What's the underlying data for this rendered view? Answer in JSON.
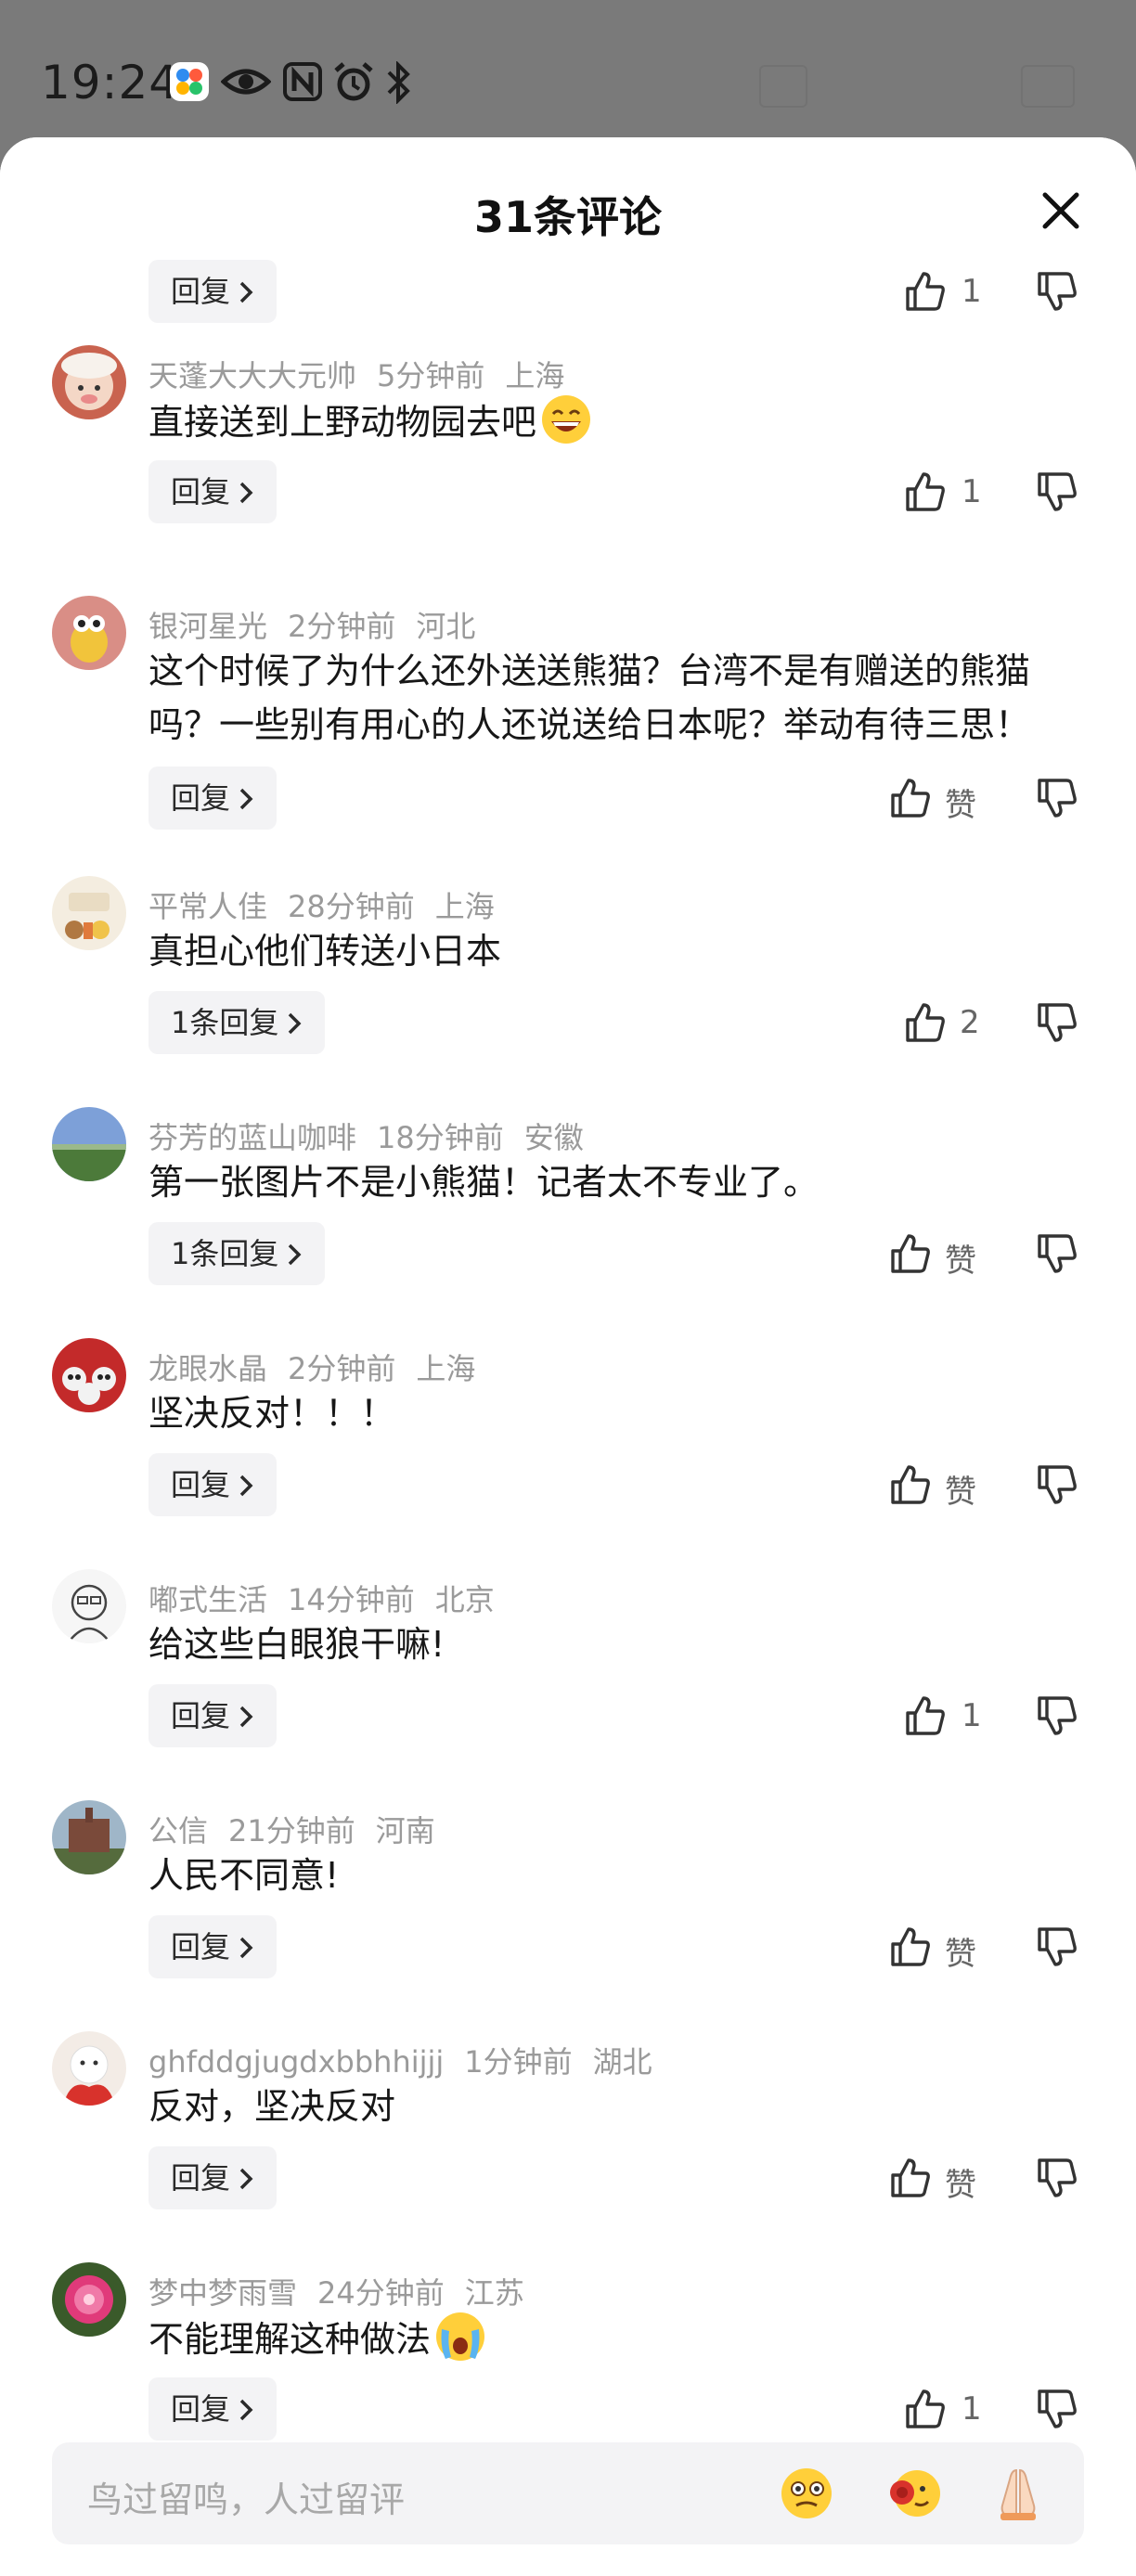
{
  "status_bar": {
    "time": "19:24",
    "icons": [
      "app-icon",
      "eye-icon",
      "nfc-icon",
      "alarm-icon",
      "bluetooth-icon"
    ]
  },
  "sheet": {
    "title": "31条评论",
    "close_icon": "close-icon"
  },
  "partial_top": {
    "reply_label": "回复",
    "like_count": "1"
  },
  "comments": [
    {
      "user": "天蓬大大大元帅",
      "time": "5分钟前",
      "location": "上海",
      "text": "直接送到上野动物园去吧",
      "emoji": "grinning-face",
      "reply_label": "回复",
      "likes": "1"
    },
    {
      "user": "银河星光",
      "time": "2分钟前",
      "location": "河北",
      "text": "这个时候了为什么还外送送熊猫？台湾不是有赠送的熊猫吗？一些别有用心的人还说送给日本呢？举动有待三思！",
      "reply_label": "回复",
      "likes": "赞"
    },
    {
      "user": "平常人佳",
      "time": "28分钟前",
      "location": "上海",
      "text": "真担心他们转送小日本",
      "reply_label": "1条回复",
      "likes": "2"
    },
    {
      "user": "芬芳的蓝山咖啡",
      "time": "18分钟前",
      "location": "安徽",
      "text": "第一张图片不是小熊猫！记者太不专业了。",
      "reply_label": "1条回复",
      "likes": "赞"
    },
    {
      "user": "龙眼水晶",
      "time": "2分钟前",
      "location": "上海",
      "text": "坚决反对！！！",
      "reply_label": "回复",
      "likes": "赞"
    },
    {
      "user": "嘟式生活",
      "time": "14分钟前",
      "location": "北京",
      "text": "给这些白眼狼干嘛!",
      "reply_label": "回复",
      "likes": "1"
    },
    {
      "user": "公信",
      "time": "21分钟前",
      "location": "河南",
      "text": "人民不同意!",
      "reply_label": "回复",
      "likes": "赞"
    },
    {
      "user": "ghfddgjugdxbbhhijjj",
      "time": "1分钟前",
      "location": "湖北",
      "text": "反对，坚决反对",
      "reply_label": "回复",
      "likes": "赞"
    },
    {
      "user": "梦中梦雨雪",
      "time": "24分钟前",
      "location": "江苏",
      "text": "不能理解这种做法",
      "emoji": "crying-face",
      "reply_label": "回复",
      "likes": "1"
    }
  ],
  "input": {
    "placeholder": "鸟过留鸣，人过留评",
    "emojis": [
      "thinking-face-emoji",
      "rose-face-emoji",
      "folded-hands-emoji"
    ]
  },
  "colors": {
    "background_dim": "#7a7a7a",
    "meta_text": "#9a9a9a",
    "reply_pill": "#f3f3f5"
  }
}
